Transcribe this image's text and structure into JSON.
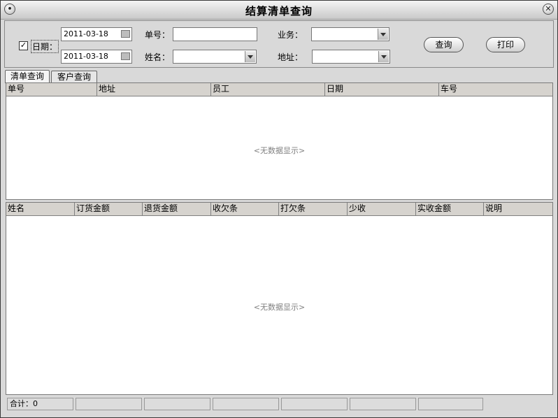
{
  "window": {
    "title": "结算清单查询",
    "menu_icon": "circle-dot-icon",
    "close_icon": "close-icon"
  },
  "filters": {
    "date_checkbox_checked": true,
    "date_label": "日期：",
    "date_from": "2011-03-18",
    "date_to": "2011-03-18",
    "order_no_label": "单号：",
    "order_no_value": "",
    "name_label": "姓名：",
    "name_value": "",
    "business_label": "业务：",
    "business_value": "",
    "address_label": "地址：",
    "address_value": "",
    "query_button": "查询",
    "print_button": "打印"
  },
  "tabs": [
    {
      "label": "清单查询",
      "active": true
    },
    {
      "label": "客户查询",
      "active": false
    }
  ],
  "grid1": {
    "columns": [
      "单号",
      "地址",
      "员工",
      "日期",
      "车号"
    ],
    "empty_text": "<无数据显示>"
  },
  "grid2": {
    "columns": [
      "姓名",
      "订货金额",
      "退货金额",
      "收欠条",
      "打欠条",
      "少收",
      "实收金额",
      "说明"
    ],
    "empty_text": "<无数据显示>"
  },
  "status": {
    "total": "合计：0",
    "cells": [
      "",
      "",
      "",
      "",
      "",
      ""
    ]
  }
}
